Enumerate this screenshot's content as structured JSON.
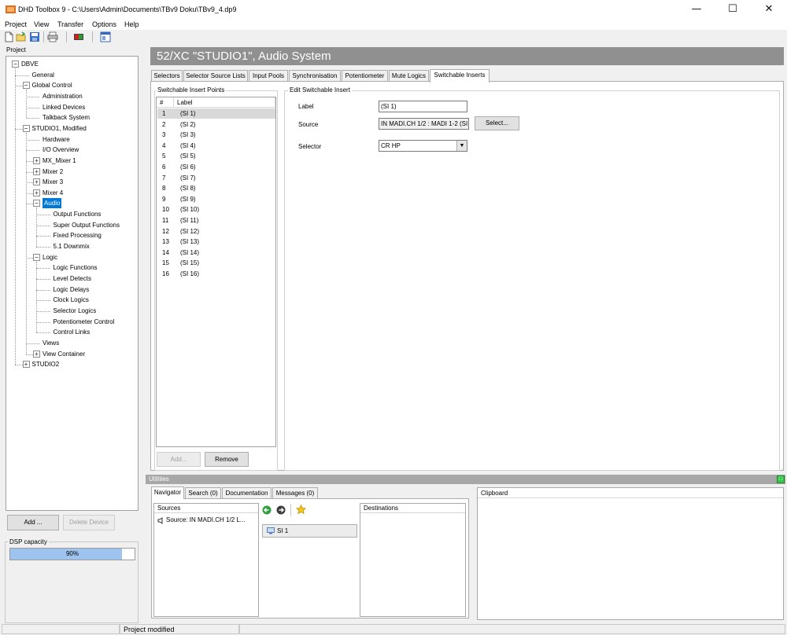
{
  "window": {
    "title": "DHD Toolbox 9 - C:\\Users\\Admin\\Documents\\TBv9 Doku\\TBv9_4.dp9",
    "minimize": "—",
    "maximize": "☐",
    "close": "✕"
  },
  "menu": {
    "items": [
      "Project",
      "View",
      "Transfer",
      "Options",
      "Help"
    ]
  },
  "toolbar": {
    "icons": [
      "new-file-icon",
      "open-folder-icon",
      "save-icon",
      "print-icon",
      "device-icon",
      "window-icon"
    ]
  },
  "project": {
    "caption": "Project",
    "tree": [
      {
        "label": "DBVE",
        "level": 0,
        "expander": "−"
      },
      {
        "label": "General",
        "level": 1
      },
      {
        "label": "Global Control",
        "level": 1,
        "expander": "−"
      },
      {
        "label": "Administration",
        "level": 2
      },
      {
        "label": "Linked Devices",
        "level": 2
      },
      {
        "label": "Talkback System",
        "level": 2
      },
      {
        "label": "STUDIO1, Modified",
        "level": 1,
        "expander": "−"
      },
      {
        "label": "Hardware",
        "level": 2
      },
      {
        "label": "I/O Overview",
        "level": 2
      },
      {
        "label": "MX_Mixer 1",
        "level": 2,
        "expander": "+"
      },
      {
        "label": "Mixer 2",
        "level": 2,
        "expander": "+"
      },
      {
        "label": "Mixer 3",
        "level": 2,
        "expander": "+"
      },
      {
        "label": "Mixer 4",
        "level": 2,
        "expander": "+"
      },
      {
        "label": "Audio",
        "level": 2,
        "expander": "−",
        "selected": true
      },
      {
        "label": "Output Functions",
        "level": 3
      },
      {
        "label": "Super Output Functions",
        "level": 3
      },
      {
        "label": "Fixed Processing",
        "level": 3
      },
      {
        "label": "5.1 Downmix",
        "level": 3
      },
      {
        "label": "Logic",
        "level": 2,
        "expander": "−"
      },
      {
        "label": "Logic Functions",
        "level": 3
      },
      {
        "label": "Level Detects",
        "level": 3
      },
      {
        "label": "Logic Delays",
        "level": 3
      },
      {
        "label": "Clock Logics",
        "level": 3
      },
      {
        "label": "Selector Logics",
        "level": 3
      },
      {
        "label": "Potentiometer Control",
        "level": 3
      },
      {
        "label": "Control Links",
        "level": 3
      },
      {
        "label": "Views",
        "level": 2
      },
      {
        "label": "View Container",
        "level": 2,
        "expander": "+"
      },
      {
        "label": "STUDIO2",
        "level": 1,
        "expander": "+"
      }
    ],
    "add_label": "Add ...",
    "delete_label": "Delete Device",
    "dsp_caption": "DSP capacity",
    "dsp_value": 90,
    "dsp_text": "90%"
  },
  "main": {
    "header": "52/XC \"STUDIO1\", Audio System",
    "tabs": [
      {
        "label": "Selectors",
        "x": 0,
        "w": 0
      },
      {
        "label": "Selector Source Lists"
      },
      {
        "label": "Input Pools"
      },
      {
        "label": "Synchronisation"
      },
      {
        "label": "Potentiometer"
      },
      {
        "label": "Mute Logics"
      },
      {
        "label": "Switchable Inserts",
        "active": true
      }
    ],
    "insert_points_caption": "Switchable Insert Points",
    "list_header": {
      "num": "#",
      "label": "Label"
    },
    "insert_points": [
      {
        "num": "1",
        "label": "(SI 1)",
        "selected": true
      },
      {
        "num": "2",
        "label": "(SI 2)"
      },
      {
        "num": "3",
        "label": "(SI 3)"
      },
      {
        "num": "4",
        "label": "(SI 4)"
      },
      {
        "num": "5",
        "label": "(SI 5)"
      },
      {
        "num": "6",
        "label": "(SI 6)"
      },
      {
        "num": "7",
        "label": "(SI 7)"
      },
      {
        "num": "8",
        "label": "(SI 8)"
      },
      {
        "num": "9",
        "label": "(SI 9)"
      },
      {
        "num": "10",
        "label": "(SI 10)"
      },
      {
        "num": "11",
        "label": "(SI 11)"
      },
      {
        "num": "12",
        "label": "(SI 12)"
      },
      {
        "num": "13",
        "label": "(SI 13)"
      },
      {
        "num": "14",
        "label": "(SI 14)"
      },
      {
        "num": "15",
        "label": "(SI 15)"
      },
      {
        "num": "16",
        "label": "(SI 16)"
      }
    ],
    "add_label": "Add...",
    "remove_label": "Remove",
    "edit": {
      "caption": "Edit Switchable Insert",
      "label_caption": "Label",
      "label_value": "(SI 1)",
      "source_caption": "Source",
      "source_value": "IN MADI.CH 1/2 : MADI 1-2 (SI",
      "select_label": "Select...",
      "selector_caption": "Selector",
      "selector_value": "CR HP"
    }
  },
  "utilities": {
    "title": "Utilities",
    "maximize": "□",
    "tabs": [
      {
        "label": "Navigator",
        "active": true
      },
      {
        "label": "Search (0)"
      },
      {
        "label": "Documentation"
      },
      {
        "label": "Messages (0)"
      }
    ],
    "sources_header": "Sources",
    "source_item": "Source: IN MADI.CH 1/2 L...",
    "assigned_item": "SI 1",
    "destinations_header": "Destinations",
    "clipboard_header": "Clipboard"
  },
  "status": {
    "text": "Project modified"
  }
}
